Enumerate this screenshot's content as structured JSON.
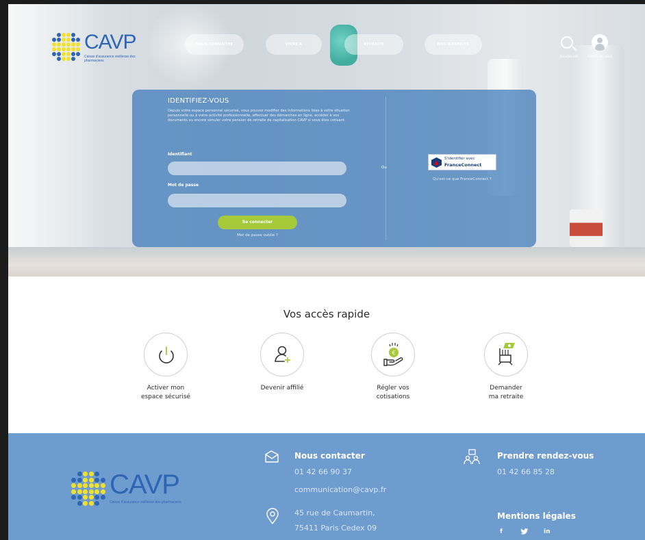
{
  "header": {
    "logo_text": "CAVP",
    "logo_subtitle": "Caisse d'assurance vieillesse des pharmaciens",
    "nav": [
      "NOUS CONNAÎTRE",
      "VIVRE A",
      "RETRAITE",
      "NOS BIENFAITS"
    ],
    "search_label": "RECHERCHER",
    "account_label": "ESPACE SÉCURISÉ"
  },
  "login": {
    "title": "IDENTIFIEZ-VOUS",
    "description": "Depuis votre espace personnel sécurisé, vous pouvez modifier des informations liées à votre situation personnelle ou à votre activité professionnelle, effectuer des démarches en ligne, accéder à vos documents ou encore simuler votre pension de retraite de capitalisation CAVP si vous êtes cotisant.",
    "id_label": "Identifiant",
    "id_value": "",
    "password_label": "Mot de passe",
    "password_value": "",
    "submit_label": "Se connecter",
    "forgot_label": "Mot de passe oublié ?",
    "or_label": "Ou",
    "franceconnect_line1": "S'identifier avec",
    "franceconnect_line2": "FranceConnect",
    "franceconnect_link": "Qu'est-ce que FranceConnect ?"
  },
  "quick_access": {
    "title": "Vos accès rapide",
    "items": [
      {
        "label_line1": "Activer mon",
        "label_line2": "espace sécurisé",
        "icon": "power-icon"
      },
      {
        "label_line1": "Devenir affilié",
        "label_line2": "",
        "icon": "add-user-icon"
      },
      {
        "label_line1": "Régler vos",
        "label_line2": "cotisations",
        "icon": "coin-hand-icon"
      },
      {
        "label_line1": "Demander",
        "label_line2": "ma retraite",
        "icon": "retirement-chair-icon"
      }
    ]
  },
  "footer": {
    "logo_text": "CAVP",
    "logo_subtitle": "Caisse d'assurance vieillesse des pharmaciens",
    "contact_title": "Nous contacter",
    "contact_phone": "01 42 66 90 37",
    "contact_email": "communication@cavp.fr",
    "address_line1": "45 rue de Caumartin,",
    "address_line2": "75411 Paris Cedex 09",
    "appointment_title": "Prendre rendez-vous",
    "appointment_phone": "01 42 66 85 28",
    "legal_title": "Mentions légales",
    "social": [
      "f",
      "in"
    ]
  },
  "colors": {
    "brand_blue": "#2e66b5",
    "brand_yellow": "#f2e12a",
    "accent_green": "#a6c93a",
    "footer_bg": "#6f9ccf",
    "card_bg": "#3c78b9"
  }
}
